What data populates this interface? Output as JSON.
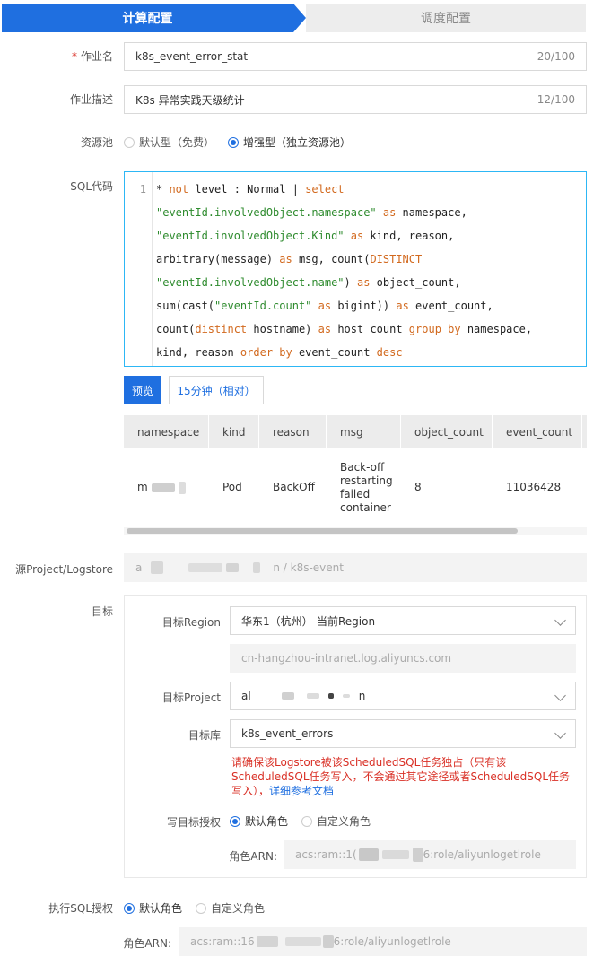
{
  "steps": {
    "active": "计算配置",
    "inactive": "调度配置"
  },
  "job_name": {
    "label": "作业名",
    "required_mark": "*",
    "value": "k8s_event_error_stat",
    "count": "20/100"
  },
  "job_desc": {
    "label": "作业描述",
    "value": "K8s 异常实践天级统计",
    "count": "12/100"
  },
  "resource_pool": {
    "label": "资源池",
    "option_default": "默认型（免费）",
    "option_enhanced": "增强型（独立资源池）",
    "selected": "增强型（独立资源池）"
  },
  "sql": {
    "label": "SQL代码",
    "line_number": "1",
    "lines": [
      [
        {
          "t": "* "
        },
        {
          "t": "not",
          "c": "kw"
        },
        {
          "t": " level : Normal | "
        },
        {
          "t": "select",
          "c": "kw"
        }
      ],
      [
        {
          "t": "\"eventId.involvedObject.namespace\"",
          "c": "str"
        },
        {
          "t": " "
        },
        {
          "t": "as",
          "c": "kw"
        },
        {
          "t": " namespace,"
        }
      ],
      [
        {
          "t": "\"eventId.involvedObject.Kind\"",
          "c": "str"
        },
        {
          "t": " "
        },
        {
          "t": "as",
          "c": "kw"
        },
        {
          "t": " kind, reason,"
        }
      ],
      [
        {
          "t": "arbitrary(message) "
        },
        {
          "t": "as",
          "c": "kw"
        },
        {
          "t": " msg, count("
        },
        {
          "t": "DISTINCT",
          "c": "kw"
        }
      ],
      [
        {
          "t": "\"eventId.involvedObject.name\"",
          "c": "str"
        },
        {
          "t": ") "
        },
        {
          "t": "as",
          "c": "kw"
        },
        {
          "t": " object_count,"
        }
      ],
      [
        {
          "t": "sum(cast("
        },
        {
          "t": "\"eventId.count\"",
          "c": "str"
        },
        {
          "t": " "
        },
        {
          "t": "as",
          "c": "kw"
        },
        {
          "t": " bigint)) "
        },
        {
          "t": "as",
          "c": "kw"
        },
        {
          "t": " event_count,"
        }
      ],
      [
        {
          "t": "count("
        },
        {
          "t": "distinct",
          "c": "kw"
        },
        {
          "t": " hostname) "
        },
        {
          "t": "as",
          "c": "kw"
        },
        {
          "t": " host_count "
        },
        {
          "t": "group by",
          "c": "kw"
        },
        {
          "t": " namespace,"
        }
      ],
      [
        {
          "t": "kind, reason "
        },
        {
          "t": "order by",
          "c": "kw"
        },
        {
          "t": " event_count "
        },
        {
          "t": "desc",
          "c": "kw"
        }
      ]
    ]
  },
  "preview": {
    "button": "预览",
    "time_range": "15分钟（相对）"
  },
  "table": {
    "columns": [
      "namespace",
      "kind",
      "reason",
      "msg",
      "object_count",
      "event_count"
    ],
    "row": {
      "namespace": "m",
      "kind": "Pod",
      "reason": "BackOff",
      "msg_lines": [
        "Back-off",
        "restarting",
        "failed",
        "container"
      ],
      "object_count": "8",
      "event_count": "11036428"
    }
  },
  "source": {
    "label": "源Project/Logstore",
    "prefix": "a",
    "suffix": "n / k8s-event"
  },
  "target": {
    "label": "目标",
    "region_label": "目标Region",
    "region_value": "华东1（杭州）-当前Region",
    "endpoint": "cn-hangzhou-intranet.log.aliyuncs.com",
    "project_label": "目标Project",
    "project_prefix": "al",
    "project_suffix": "n",
    "store_label": "目标库",
    "store_value": "k8s_event_errors",
    "warning": "请确保该Logstore被该ScheduledSQL任务独占（只有该ScheduledSQL任务写入，不会通过其它途径或者ScheduledSQL任务写入），",
    "warning_link": "详细参考文档",
    "auth_label": "写目标授权",
    "auth_default": "默认角色",
    "auth_custom": "自定义角色",
    "arn_label": "角色ARN:",
    "arn_prefix": "acs:ram::1(",
    "arn_suffix": "6:role/aliyunlogetlrole"
  },
  "exec_auth": {
    "label": "执行SQL授权",
    "default": "默认角色",
    "custom": "自定义角色",
    "arn_label": "角色ARN:",
    "arn_prefix": "acs:ram::16",
    "arn_suffix": "6:role/aliyunlogetlrole"
  },
  "colors": {
    "primary": "#1f6fe0",
    "warning": "#d93026",
    "code_border": "#2db7f5",
    "keyword": "#d2691e",
    "string": "#2e8b2e"
  }
}
